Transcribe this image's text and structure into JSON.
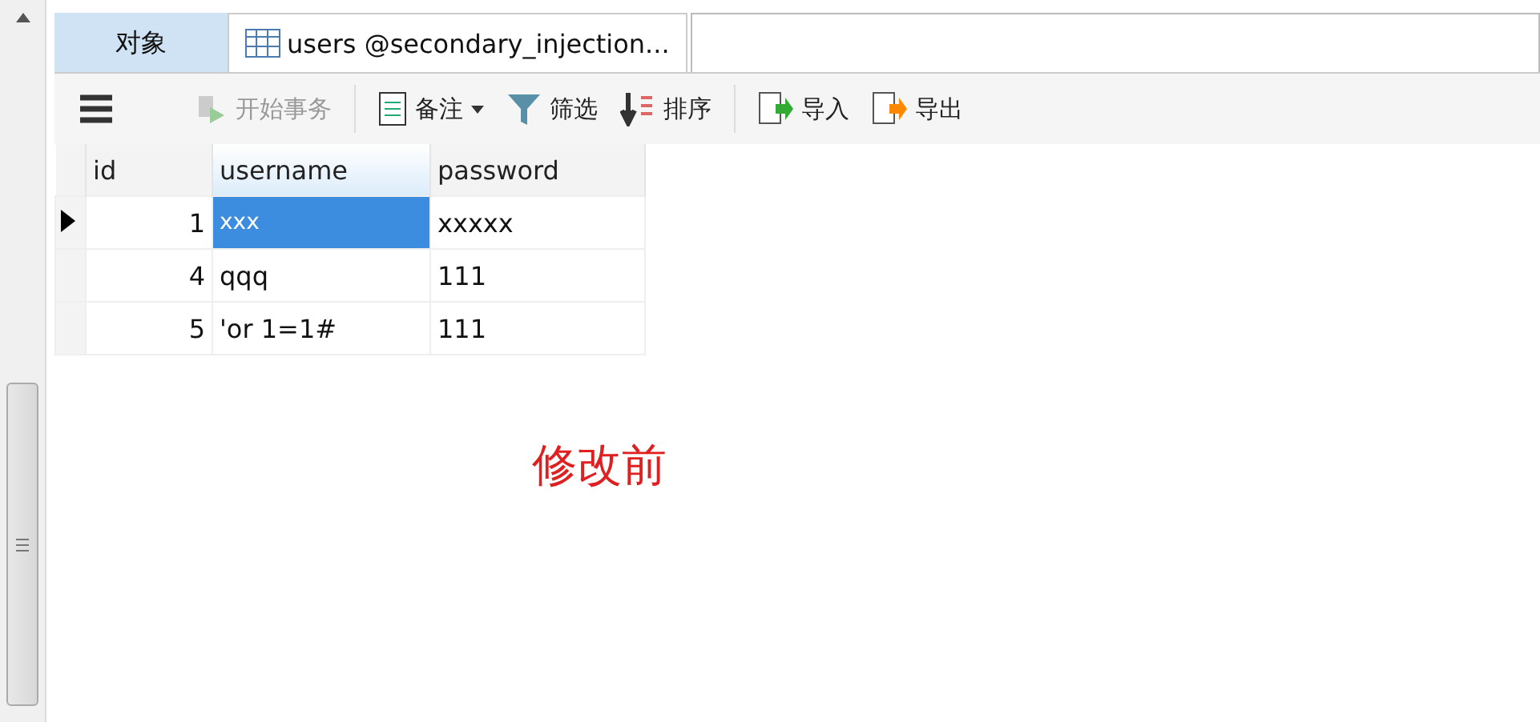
{
  "tabs": [
    {
      "label": "对象",
      "selected": false,
      "kind": "text"
    },
    {
      "label": "users @secondary_injection...",
      "selected": true,
      "kind": "table"
    }
  ],
  "toolbar": [
    {
      "kind": "menu"
    },
    {
      "kind": "begin",
      "label": "开始事务",
      "disabled": true
    },
    {
      "kind": "separator"
    },
    {
      "kind": "memo",
      "label": "备注",
      "disabled": false
    },
    {
      "kind": "filter",
      "label": "筛选",
      "disabled": false
    },
    {
      "kind": "sort",
      "label": "排序",
      "disabled": false
    },
    {
      "kind": "separator"
    },
    {
      "kind": "import",
      "label": "导入",
      "disabled": false
    },
    {
      "kind": "export",
      "label": "导出",
      "disabled": false
    }
  ],
  "table": {
    "columns": [
      "id",
      "username",
      "password"
    ],
    "rows": [
      {
        "selected": true,
        "cells": [
          {
            "text": "1",
            "selected": false
          },
          {
            "text": "xxx",
            "selected": true
          },
          {
            "text": "xxxxx",
            "selected": false
          }
        ]
      },
      {
        "selected": false,
        "cells": [
          {
            "text": "4",
            "selected": false
          },
          {
            "text": "qqq",
            "selected": false
          },
          {
            "text": "111",
            "selected": false
          }
        ]
      },
      {
        "selected": false,
        "cells": [
          {
            "text": "5",
            "selected": false
          },
          {
            "text": "'or 1=1#",
            "selected": false
          },
          {
            "text": "111",
            "selected": false
          }
        ]
      }
    ]
  },
  "annotation": "修改前"
}
